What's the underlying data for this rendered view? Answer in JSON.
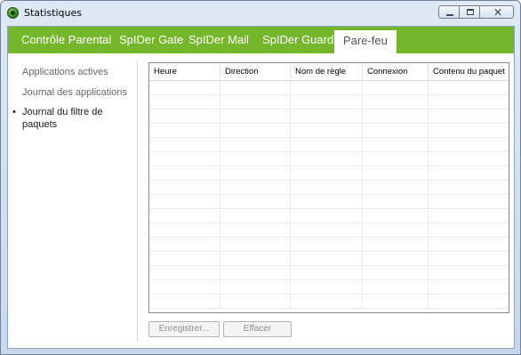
{
  "window": {
    "title": "Statistiques"
  },
  "tabs": [
    {
      "label": "Contrôle Parental",
      "active": false
    },
    {
      "label": "SpIDer Gate",
      "active": false
    },
    {
      "label": "SpIDer Mail",
      "active": false
    },
    {
      "label": "SpIDer Guard",
      "active": false
    },
    {
      "label": "Pare-feu",
      "active": true
    }
  ],
  "sidebar": {
    "items": [
      {
        "label": "Applications actives",
        "active": false
      },
      {
        "label": "Journal des applications",
        "active": false
      },
      {
        "label": "Journal du filtre de paquets",
        "active": true
      }
    ],
    "bullet": "•"
  },
  "table": {
    "columns": [
      "Heure",
      "Direction",
      "Nom de règle",
      "Connexion",
      "Contenu du paquet"
    ],
    "rows": []
  },
  "buttons": {
    "save_label": "Enregistrer...",
    "clear_label": "Effacer"
  },
  "colors": {
    "tab_bar": "#75b72b",
    "accent": "#75b72b"
  }
}
